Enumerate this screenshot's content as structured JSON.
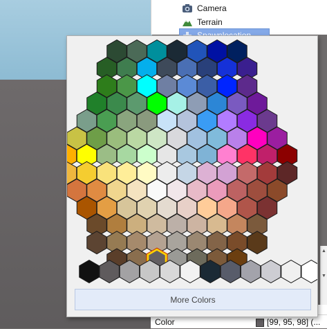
{
  "explorer": {
    "items": [
      {
        "label": "Camera",
        "icon": "camera-icon"
      },
      {
        "label": "Terrain",
        "icon": "terrain-icon"
      },
      {
        "label": "Spawnlocation",
        "icon": "spawnlocation-icon",
        "selected": true
      }
    ]
  },
  "properties": {
    "row": {
      "name": "Color",
      "value": "[99, 95, 98] (...",
      "swatch_color": "#635f62"
    }
  },
  "popup": {
    "more_colors_label": "More Colors",
    "selected_highlight_color": "#ffd000",
    "hex_rows": [
      [
        "#2c4a33",
        "#4b6a57",
        "#008f9c",
        "#1b2a35",
        "#2154b9",
        "#0011a3",
        "#00205f"
      ],
      [
        "#275e25",
        "#3f7d4f",
        "#04afec",
        "#3e4a5a",
        "#4a6fb4",
        "#29407a",
        "#1531d8",
        "#3a1f8f"
      ],
      [
        "#2e7d1b",
        "#4b9748",
        "#00ffff",
        "#6f7fa3",
        "#5b8ad6",
        "#3b5ea6",
        "#0025ff",
        "#5d2a8c"
      ],
      [
        "#20802a",
        "#3b8a4c",
        "#5c9a6e",
        "#00ff00",
        "#a6f1e6",
        "#8e9db5",
        "#2c86d6",
        "#7a5ac0",
        "#6e1a9a"
      ],
      [
        "#7a9e8b",
        "#4a9e52",
        "#8aa57e",
        "#8a9a7e",
        "#c8e2f8",
        "#b4c3dc",
        "#3a9cf4",
        "#b27cff",
        "#8a2be2",
        "#6b3a8e"
      ],
      [
        "#c8c245",
        "#6e9e48",
        "#9abd7d",
        "#bad8a3",
        "#cee6c5",
        "#d9d9dd",
        "#a1c1e0",
        "#80bbdb",
        "#b980ea",
        "#ff00bf",
        "#9b1ea0"
      ],
      [
        "#ffb000",
        "#ffff00",
        "#9bbd86",
        "#a7d8a1",
        "#ccffcc",
        "#e6e6e6",
        "#a8c8e0",
        "#7fb3d6",
        "#ff80d0",
        "#ff3366",
        "#c0206a",
        "#8c0000"
      ],
      [
        "#efb73e",
        "#f5cd30",
        "#f9e27b",
        "#ffee99",
        "#fffbc4",
        "#ededed",
        "#c5d6e6",
        "#ddb1d4",
        "#d3a2d4",
        "#c46a6a",
        "#a33b3b",
        "#5d2727"
      ],
      [
        "#d4753e",
        "#e08b42",
        "#f0d68e",
        "#f4e3c0",
        "#f9f9f9",
        "#f1e6ea",
        "#e8bac8",
        "#eb9bbb",
        "#bd6262",
        "#9e4e3e",
        "#8b4a2a"
      ],
      [
        "#aa5500",
        "#e49e44",
        "#d7c59a",
        "#e0d2b0",
        "#e4dbd0",
        "#e8d0c8",
        "#ffcc99",
        "#f5a78a",
        "#b0554a",
        "#7b3232"
      ],
      [
        "#6b4a2a",
        "#b07e3e",
        "#ccaf7e",
        "#cfbb9f",
        "#bcb0a8",
        "#cdb4a2",
        "#d8ba90",
        "#c4865e",
        "#7b5a3c"
      ],
      [
        "#5c4432",
        "#967b53",
        "#a68a6c",
        "#b4a292",
        "#a9a49d",
        "#9b8872",
        "#836448",
        "#7a4c2a",
        "#5a3a1a"
      ],
      [
        "#5a3e2a",
        "#8a6e4e",
        "#635f62",
        "#9a9a96",
        "#6d6b5c",
        "#7c5a3a",
        "#6b3e10"
      ]
    ],
    "gray_row": [
      "#111111",
      "#5f5b5d",
      "#a3a2a4",
      "#c7c7c7",
      "#d8d8d8",
      "#f2f2f2",
      "#1b2a35",
      "#585c6a",
      "#a3a3ab",
      "#cdcdd3",
      "#f0f0f0",
      "#ffffff"
    ],
    "selected_color": "#635f62"
  }
}
